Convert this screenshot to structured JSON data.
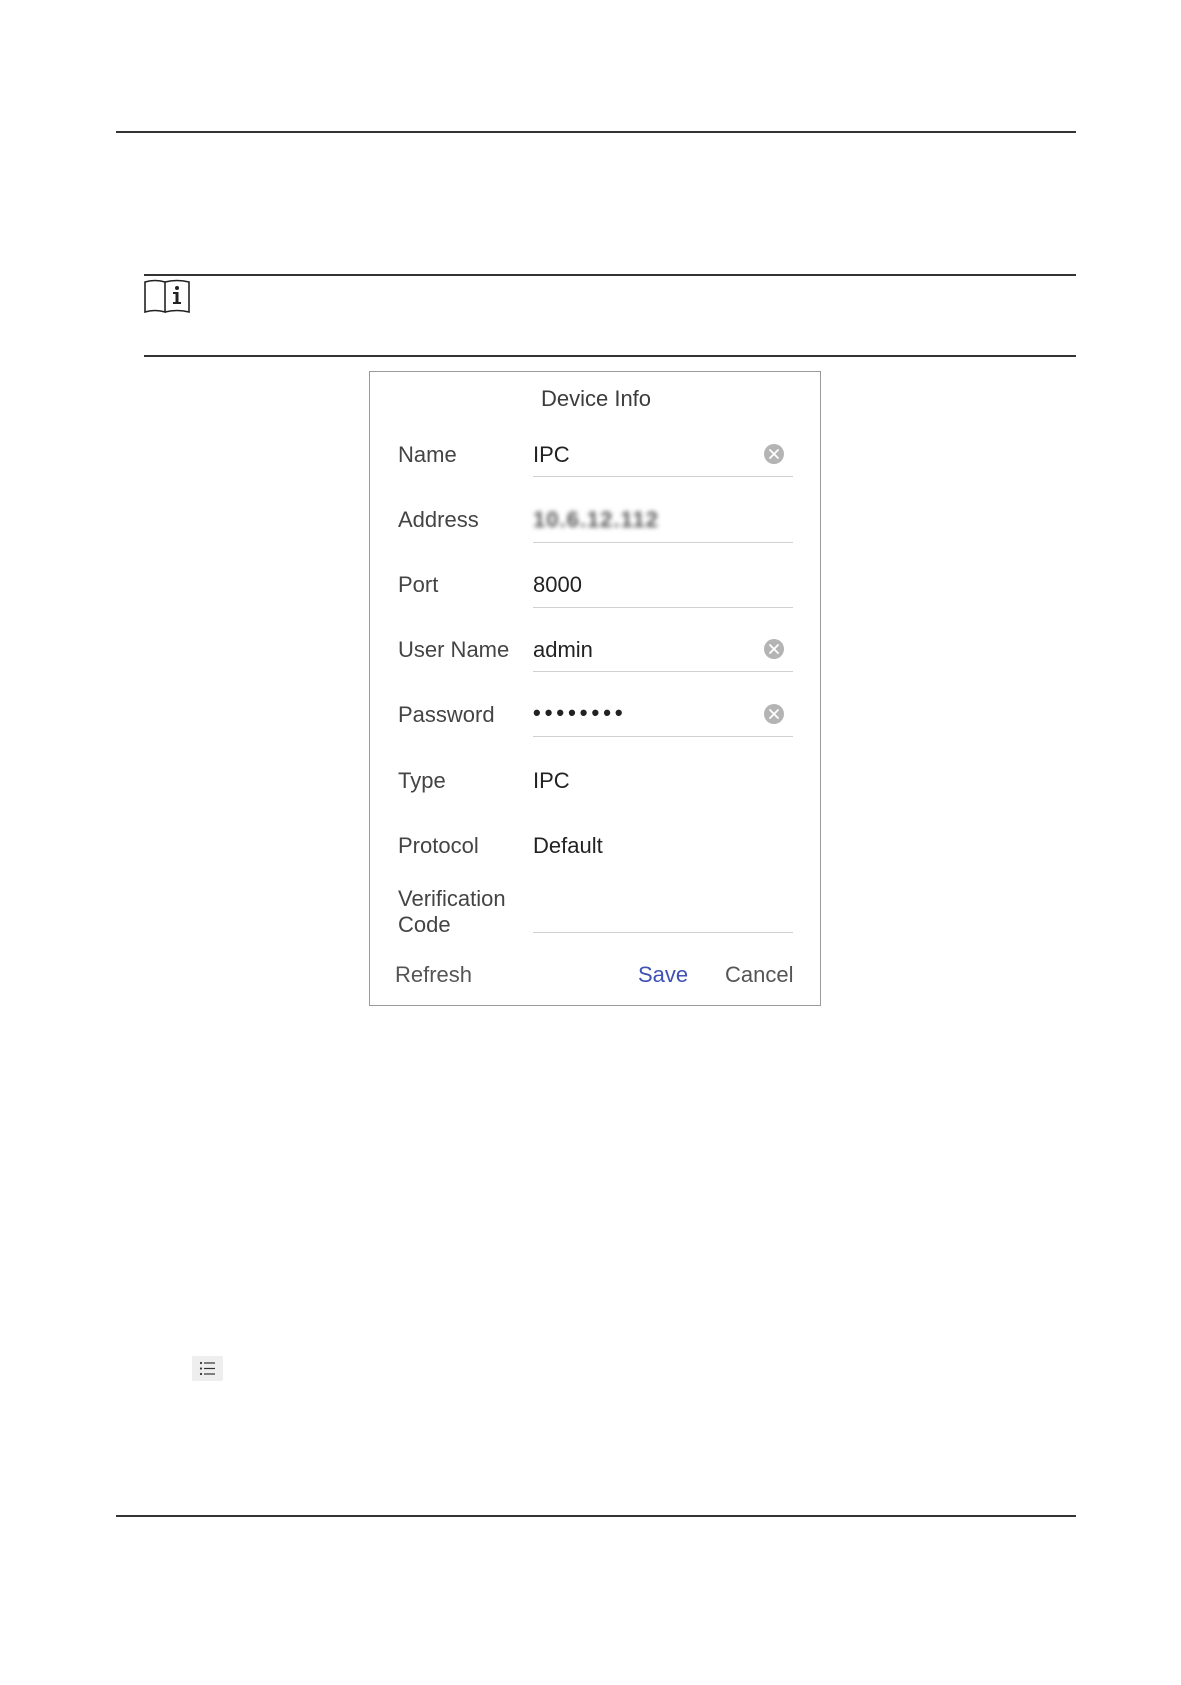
{
  "dialog": {
    "title": "Device Info",
    "fields": [
      {
        "label": "Name",
        "value": "IPC"
      },
      {
        "label": "Address",
        "value": "10.6.12.112"
      },
      {
        "label": "Port",
        "value": "8000"
      },
      {
        "label": "User Name",
        "value": "admin"
      },
      {
        "label": "Password",
        "value": "••••••••"
      },
      {
        "label": "Type",
        "value": "IPC"
      },
      {
        "label": "Protocol",
        "value": "Default"
      },
      {
        "label": "Verification Code",
        "value": ""
      }
    ],
    "buttons": {
      "refresh": "Refresh",
      "save": "Save",
      "cancel": "Cancel"
    }
  },
  "icons": {
    "note": "note-info-icon",
    "list": "list-icon",
    "clear": "clear-icon"
  },
  "colors": {
    "accent": "#3f51b5",
    "rule": "#333333"
  }
}
